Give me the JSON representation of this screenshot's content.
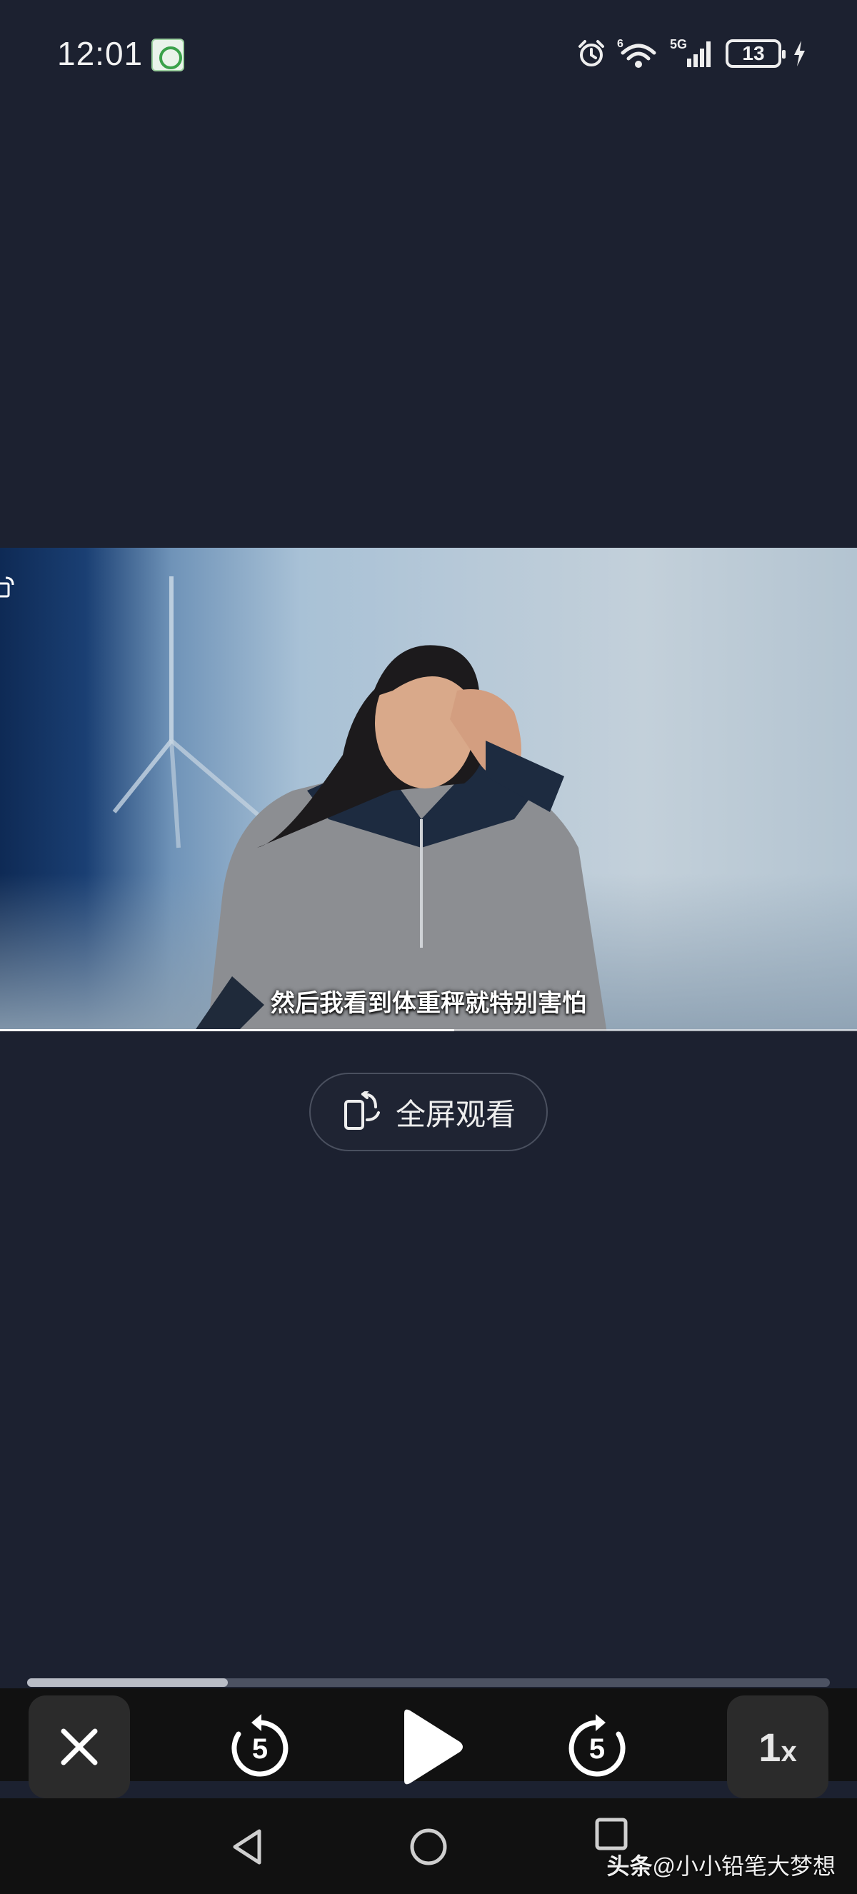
{
  "status_bar": {
    "time": "12:01",
    "network": "5G",
    "wifi_sup": "6",
    "battery": "13"
  },
  "video": {
    "subtitle": "然后我看到体重秤就特别害怕",
    "progress": 0.53
  },
  "fullscreen_button": {
    "label": "全屏观看"
  },
  "player": {
    "progress": 0.25,
    "rewind_seconds": "5",
    "forward_seconds": "5",
    "speed_value": "1",
    "speed_unit": "x"
  },
  "watermark": {
    "source": "头条",
    "author": "@小小铅笔大梦想"
  },
  "colors": {
    "background": "#1c2130",
    "controls_bg": "#111111",
    "button_bg": "#2b2b2b"
  }
}
